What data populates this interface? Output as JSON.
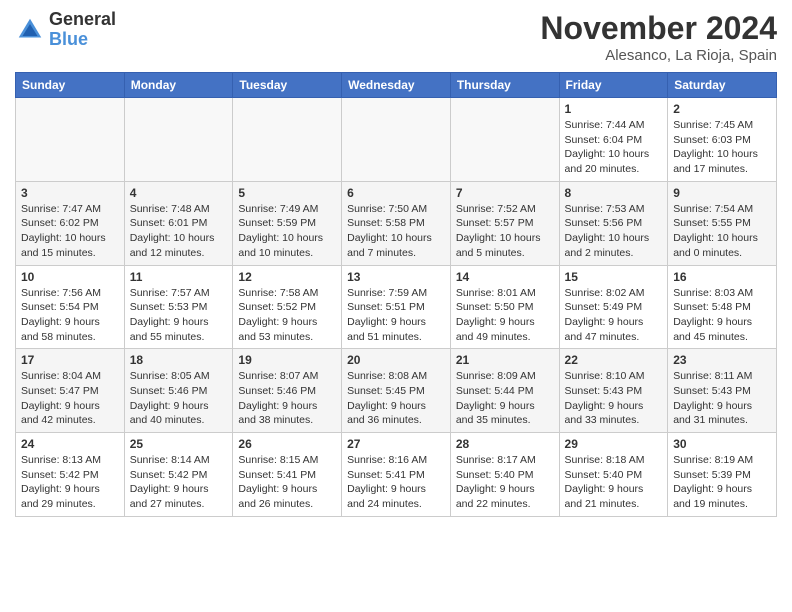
{
  "header": {
    "logo_line1": "General",
    "logo_line2": "Blue",
    "month_title": "November 2024",
    "location": "Alesanco, La Rioja, Spain"
  },
  "days_of_week": [
    "Sunday",
    "Monday",
    "Tuesday",
    "Wednesday",
    "Thursday",
    "Friday",
    "Saturday"
  ],
  "weeks": [
    {
      "days": [
        {
          "num": "",
          "info": "",
          "empty": true
        },
        {
          "num": "",
          "info": "",
          "empty": true
        },
        {
          "num": "",
          "info": "",
          "empty": true
        },
        {
          "num": "",
          "info": "",
          "empty": true
        },
        {
          "num": "",
          "info": "",
          "empty": true
        },
        {
          "num": "1",
          "info": "Sunrise: 7:44 AM\nSunset: 6:04 PM\nDaylight: 10 hours and 20 minutes.",
          "empty": false
        },
        {
          "num": "2",
          "info": "Sunrise: 7:45 AM\nSunset: 6:03 PM\nDaylight: 10 hours and 17 minutes.",
          "empty": false
        }
      ]
    },
    {
      "days": [
        {
          "num": "3",
          "info": "Sunrise: 7:47 AM\nSunset: 6:02 PM\nDaylight: 10 hours and 15 minutes.",
          "empty": false
        },
        {
          "num": "4",
          "info": "Sunrise: 7:48 AM\nSunset: 6:01 PM\nDaylight: 10 hours and 12 minutes.",
          "empty": false
        },
        {
          "num": "5",
          "info": "Sunrise: 7:49 AM\nSunset: 5:59 PM\nDaylight: 10 hours and 10 minutes.",
          "empty": false
        },
        {
          "num": "6",
          "info": "Sunrise: 7:50 AM\nSunset: 5:58 PM\nDaylight: 10 hours and 7 minutes.",
          "empty": false
        },
        {
          "num": "7",
          "info": "Sunrise: 7:52 AM\nSunset: 5:57 PM\nDaylight: 10 hours and 5 minutes.",
          "empty": false
        },
        {
          "num": "8",
          "info": "Sunrise: 7:53 AM\nSunset: 5:56 PM\nDaylight: 10 hours and 2 minutes.",
          "empty": false
        },
        {
          "num": "9",
          "info": "Sunrise: 7:54 AM\nSunset: 5:55 PM\nDaylight: 10 hours and 0 minutes.",
          "empty": false
        }
      ]
    },
    {
      "days": [
        {
          "num": "10",
          "info": "Sunrise: 7:56 AM\nSunset: 5:54 PM\nDaylight: 9 hours and 58 minutes.",
          "empty": false
        },
        {
          "num": "11",
          "info": "Sunrise: 7:57 AM\nSunset: 5:53 PM\nDaylight: 9 hours and 55 minutes.",
          "empty": false
        },
        {
          "num": "12",
          "info": "Sunrise: 7:58 AM\nSunset: 5:52 PM\nDaylight: 9 hours and 53 minutes.",
          "empty": false
        },
        {
          "num": "13",
          "info": "Sunrise: 7:59 AM\nSunset: 5:51 PM\nDaylight: 9 hours and 51 minutes.",
          "empty": false
        },
        {
          "num": "14",
          "info": "Sunrise: 8:01 AM\nSunset: 5:50 PM\nDaylight: 9 hours and 49 minutes.",
          "empty": false
        },
        {
          "num": "15",
          "info": "Sunrise: 8:02 AM\nSunset: 5:49 PM\nDaylight: 9 hours and 47 minutes.",
          "empty": false
        },
        {
          "num": "16",
          "info": "Sunrise: 8:03 AM\nSunset: 5:48 PM\nDaylight: 9 hours and 45 minutes.",
          "empty": false
        }
      ]
    },
    {
      "days": [
        {
          "num": "17",
          "info": "Sunrise: 8:04 AM\nSunset: 5:47 PM\nDaylight: 9 hours and 42 minutes.",
          "empty": false
        },
        {
          "num": "18",
          "info": "Sunrise: 8:05 AM\nSunset: 5:46 PM\nDaylight: 9 hours and 40 minutes.",
          "empty": false
        },
        {
          "num": "19",
          "info": "Sunrise: 8:07 AM\nSunset: 5:46 PM\nDaylight: 9 hours and 38 minutes.",
          "empty": false
        },
        {
          "num": "20",
          "info": "Sunrise: 8:08 AM\nSunset: 5:45 PM\nDaylight: 9 hours and 36 minutes.",
          "empty": false
        },
        {
          "num": "21",
          "info": "Sunrise: 8:09 AM\nSunset: 5:44 PM\nDaylight: 9 hours and 35 minutes.",
          "empty": false
        },
        {
          "num": "22",
          "info": "Sunrise: 8:10 AM\nSunset: 5:43 PM\nDaylight: 9 hours and 33 minutes.",
          "empty": false
        },
        {
          "num": "23",
          "info": "Sunrise: 8:11 AM\nSunset: 5:43 PM\nDaylight: 9 hours and 31 minutes.",
          "empty": false
        }
      ]
    },
    {
      "days": [
        {
          "num": "24",
          "info": "Sunrise: 8:13 AM\nSunset: 5:42 PM\nDaylight: 9 hours and 29 minutes.",
          "empty": false
        },
        {
          "num": "25",
          "info": "Sunrise: 8:14 AM\nSunset: 5:42 PM\nDaylight: 9 hours and 27 minutes.",
          "empty": false
        },
        {
          "num": "26",
          "info": "Sunrise: 8:15 AM\nSunset: 5:41 PM\nDaylight: 9 hours and 26 minutes.",
          "empty": false
        },
        {
          "num": "27",
          "info": "Sunrise: 8:16 AM\nSunset: 5:41 PM\nDaylight: 9 hours and 24 minutes.",
          "empty": false
        },
        {
          "num": "28",
          "info": "Sunrise: 8:17 AM\nSunset: 5:40 PM\nDaylight: 9 hours and 22 minutes.",
          "empty": false
        },
        {
          "num": "29",
          "info": "Sunrise: 8:18 AM\nSunset: 5:40 PM\nDaylight: 9 hours and 21 minutes.",
          "empty": false
        },
        {
          "num": "30",
          "info": "Sunrise: 8:19 AM\nSunset: 5:39 PM\nDaylight: 9 hours and 19 minutes.",
          "empty": false
        }
      ]
    }
  ]
}
